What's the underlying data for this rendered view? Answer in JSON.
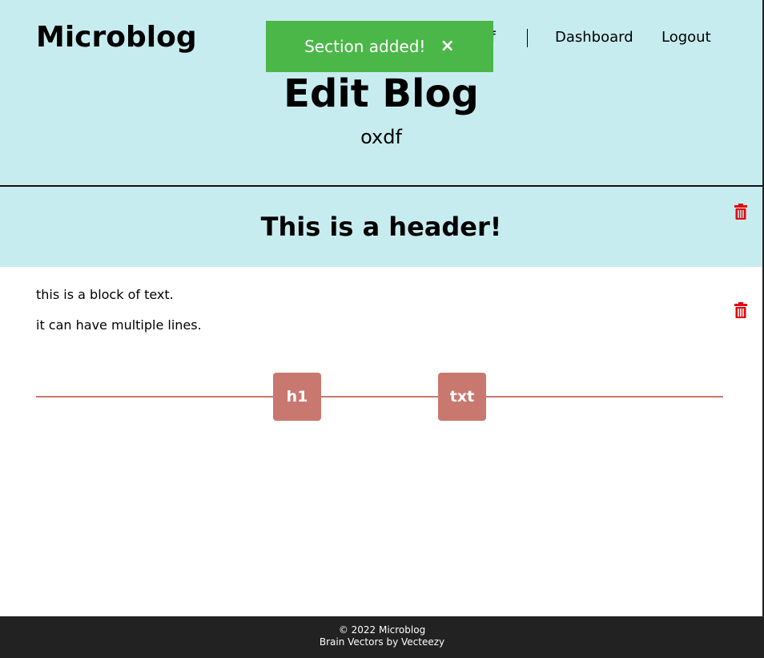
{
  "app": {
    "title": "Microblog"
  },
  "nav": {
    "user": "oxdf",
    "dashboard": "Dashboard",
    "logout": "Logout"
  },
  "page": {
    "title": "Edit Blog",
    "subtitle": "oxdf"
  },
  "toast": {
    "message": "Section added!",
    "close": "×"
  },
  "sections": [
    {
      "type": "h1",
      "text": "This is a header!"
    },
    {
      "type": "txt",
      "lines": [
        "this is a block of text.",
        "it can have multiple lines."
      ]
    }
  ],
  "add_buttons": {
    "h1": "h1",
    "txt": "txt"
  },
  "footer": {
    "copyright": "© 2022 Microblog",
    "credit": "Brain Vectors by Vecteezy"
  },
  "colors": {
    "header_bg": "#c7ecef",
    "toast_bg": "#4bb749",
    "accent": "#c9786f",
    "trash": "#e3070d",
    "footer_bg": "#222222"
  },
  "icons": [
    "trash-icon",
    "close-icon"
  ]
}
